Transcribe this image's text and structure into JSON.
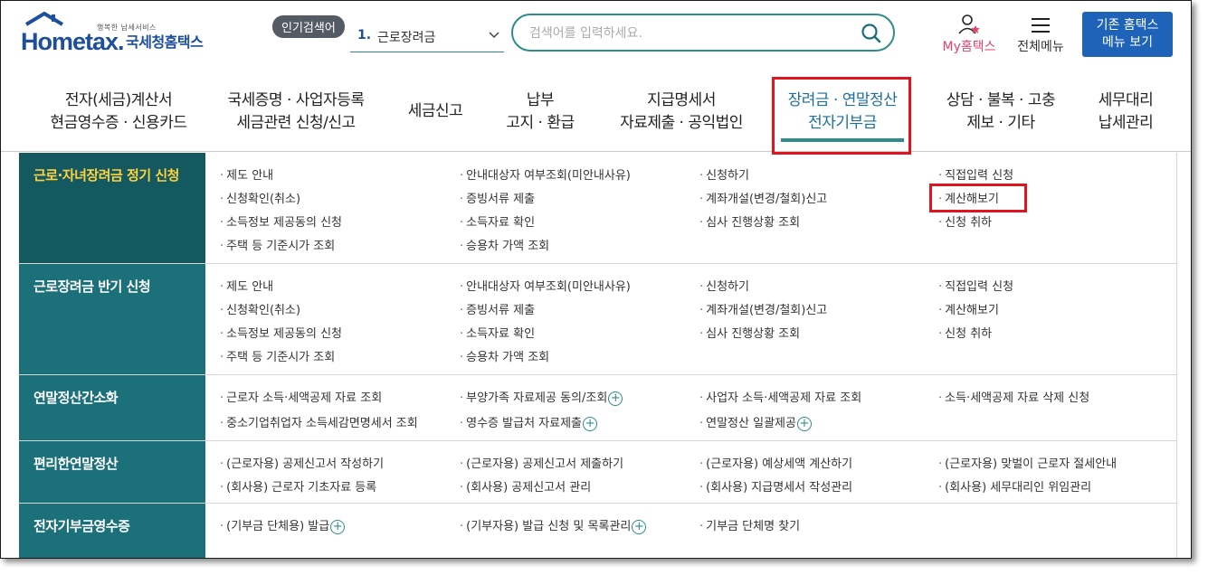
{
  "header": {
    "logo_small": "행복한 납세서비스",
    "logo_main": "Hometax.",
    "logo_sub": "국세청홈택스",
    "popular_badge": "인기검색어",
    "popular_num": "1.",
    "popular_text": "근로장려금",
    "search_placeholder": "검색어를 입력하세요.",
    "my_label": "My홈택스",
    "allmenu_label": "전체메뉴",
    "old_menu_line1": "기존 홈택스",
    "old_menu_line2": "메뉴 보기"
  },
  "nav": [
    {
      "line1": "전자(세금)계산서",
      "line2": "현금영수증 · 신용카드"
    },
    {
      "line1": "국세증명 · 사업자등록",
      "line2": "세금관련 신청/신고"
    },
    {
      "line1": "세금신고",
      "line2": ""
    },
    {
      "line1": "납부",
      "line2": "고지 · 환급"
    },
    {
      "line1": "지급명세서",
      "line2": "자료제출 · 공익법인"
    },
    {
      "line1": "장려금 · 연말정산",
      "line2": "전자기부금"
    },
    {
      "line1": "상담 · 불복 · 고충",
      "line2": "제보 · 기타"
    },
    {
      "line1": "세무대리",
      "line2": "납세관리"
    }
  ],
  "rows": [
    {
      "title": "근로·자녀장려금 정기 신청",
      "items": [
        "제도 안내",
        "안내대상자 여부조회(미안내사유)",
        "신청하기",
        "직접입력 신청",
        "신청확인(취소)",
        "증빙서류 제출",
        "계좌개설(변경/철회)신고",
        "계산해보기",
        "소득정보 제공동의 신청",
        "소득자료 확인",
        "심사 진행상황 조회",
        "신청 취하",
        "주택 등 기준시가 조회",
        "승용차 가액 조회"
      ]
    },
    {
      "title": "근로장려금 반기 신청",
      "items": [
        "제도 안내",
        "안내대상자 여부조회(미안내사유)",
        "신청하기",
        "직접입력 신청",
        "신청확인(취소)",
        "증빙서류 제출",
        "계좌개설(변경/철회)신고",
        "계산해보기",
        "소득정보 제공동의 신청",
        "소득자료 확인",
        "심사 진행상황 조회",
        "신청 취하",
        "주택 등 기준시가 조회",
        "승용차 가액 조회"
      ]
    },
    {
      "title": "연말정산간소화",
      "items": [
        "근로자 소득·세액공제 자료 조회",
        "부양가족 자료제공 동의/조회",
        "사업자 소득·세액공제 자료 조회",
        "소득·세액공제 자료 삭제 신청",
        "중소기업취업자 소득세감면명세서 조회",
        "영수증 발급처 자료제출",
        "연말정산 일괄제공"
      ]
    },
    {
      "title": "편리한연말정산",
      "items": [
        "(근로자용) 공제신고서 작성하기",
        "(근로자용) 공제신고서 제출하기",
        "(근로자용) 예상세액 계산하기",
        "(근로자용) 맞벌이 근로자 절세안내",
        "(회사용) 근로자 기초자료 등록",
        "(회사용) 공제신고서 관리",
        "(회사용) 지급명세서 작성관리",
        "(회사용) 세무대리인 위임관리"
      ]
    },
    {
      "title": "전자기부금영수증",
      "items": [
        "(기부금 단체용) 발급",
        "(기부자용) 발급 신청 및 목록관리",
        "기부금 단체명 찾기"
      ]
    }
  ]
}
